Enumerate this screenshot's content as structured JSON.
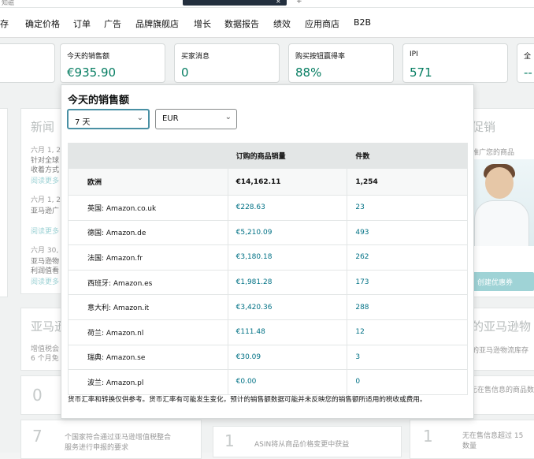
{
  "window": {
    "title_fragment": "知磁"
  },
  "nav": {
    "items": [
      "存",
      "确定价格",
      "订单",
      "广告",
      "品牌旗舰店",
      "增长",
      "数据报告",
      "绩效",
      "应用商店",
      "B2B"
    ]
  },
  "metric_cards": [
    {
      "label": "今天的销售额",
      "value": "€935.90"
    },
    {
      "label": "买家消息",
      "value": "0"
    },
    {
      "label": "购买按钮赢得率",
      "value": "88%"
    },
    {
      "label": "IPI",
      "value": "571"
    },
    {
      "label": "全",
      "value": "--"
    }
  ],
  "background": {
    "news_title": "新闻",
    "news_items": [
      "六月 1, 2",
      "针对全球",
      "收着方式",
      "阅读更多",
      "六月 1, 2",
      "亚马逊广",
      "阅读更多",
      "六月 30, 2",
      "亚马逊物",
      "利润值看",
      "阅读更多"
    ],
    "promo_title": "促销",
    "promo_text": "推广您的商品",
    "promo_button": "创建优惠券",
    "lower_title": "亚马逊",
    "lower_sub1": "增值税会",
    "lower_sub2": "6 个月免",
    "lower_right_title": "的亚马逊物",
    "lower_right_sub": "的亚马逊物流库存",
    "row_a_num": "0",
    "row_b_num": "7",
    "row_b_text1": "个国家符合通过亚马逊增值税整合",
    "row_b_text2": "服务进行申报的要求",
    "row_b_mid_num": "1",
    "row_b_mid_text": "ASIN将从商品价格变更中获益",
    "row_b_right_num": "1",
    "row_a_right_text": "无在售信息的商品数",
    "row_b_right_text1": "无在售信息超过 15",
    "row_b_right_text2": "数量"
  },
  "popup": {
    "title": "今天的销售额",
    "period_select": "7 天",
    "currency_select": "EUR",
    "table": {
      "headers": [
        "",
        "订购的商品销量",
        "件数"
      ],
      "total": {
        "region": "欧洲",
        "sales": "€14,162.11",
        "units": "1,254"
      },
      "rows": [
        {
          "region": "英国: Amazon.co.uk",
          "sales": "€228.63",
          "units": "23"
        },
        {
          "region": "德国: Amazon.de",
          "sales": "€5,210.09",
          "units": "493"
        },
        {
          "region": "法国: Amazon.fr",
          "sales": "€3,180.18",
          "units": "262"
        },
        {
          "region": "西班牙: Amazon.es",
          "sales": "€1,981.28",
          "units": "173"
        },
        {
          "region": "意大利: Amazon.it",
          "sales": "€3,420.36",
          "units": "288"
        },
        {
          "region": "荷兰: Amazon.nl",
          "sales": "€111.48",
          "units": "12"
        },
        {
          "region": "瑞典: Amazon.se",
          "sales": "€30.09",
          "units": "3"
        },
        {
          "region": "波兰: Amazon.pl",
          "sales": "€0.00",
          "units": "0"
        }
      ]
    },
    "note": "货币汇率和转换仅供参考。货币汇率有可能发生变化，预计的销售额数据可能并未反映您的销售额所适用的税收或费用。"
  },
  "colors": {
    "accent": "#067d62",
    "link": "#007185"
  }
}
